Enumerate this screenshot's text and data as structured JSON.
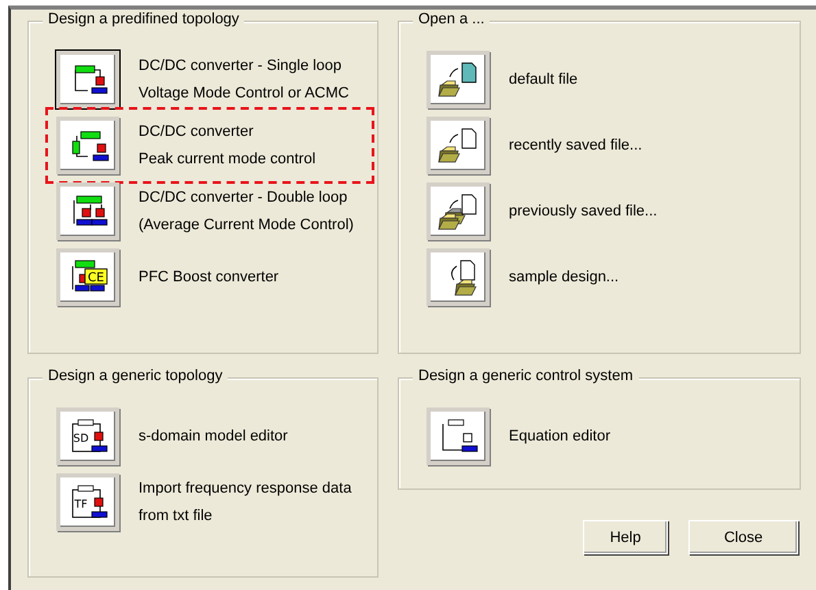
{
  "groups": [
    {
      "title": "Design a predifined topology",
      "items": [
        {
          "kind": "single",
          "lines": [
            "DC/DC converter - Single loop",
            "Voltage Mode Control or ACMC"
          ],
          "focused": true,
          "highlighted": false
        },
        {
          "kind": "peak",
          "lines": [
            "DC/DC converter",
            "Peak current mode control"
          ],
          "focused": false,
          "highlighted": true
        },
        {
          "kind": "double",
          "lines": [
            "DC/DC converter - Double loop",
            "(Average Current Mode Control)"
          ],
          "focused": false,
          "highlighted": false
        },
        {
          "kind": "pfc",
          "lines": [
            "PFC Boost converter"
          ],
          "icon_text": "CE",
          "focused": false,
          "highlighted": false
        }
      ]
    },
    {
      "title": "Open a ...",
      "items": [
        {
          "kind": "default-file",
          "lines": [
            "default file"
          ],
          "focused": false,
          "highlighted": false
        },
        {
          "kind": "recent",
          "lines": [
            "recently saved file..."
          ],
          "focused": false,
          "highlighted": false
        },
        {
          "kind": "previous",
          "lines": [
            "previously saved file..."
          ],
          "focused": false,
          "highlighted": false
        },
        {
          "kind": "sample",
          "lines": [
            "sample design..."
          ],
          "focused": false,
          "highlighted": false
        }
      ]
    },
    {
      "title": "Design a generic topology",
      "items": [
        {
          "kind": "model",
          "lines": [
            "s-domain model editor"
          ],
          "icon_text": "SD",
          "focused": false,
          "highlighted": false
        },
        {
          "kind": "model",
          "lines": [
            "Import frequency response data",
            "from txt file"
          ],
          "icon_text": "TF",
          "focused": false,
          "highlighted": false
        }
      ]
    },
    {
      "title": "Design a generic control system",
      "items": [
        {
          "kind": "equation",
          "lines": [
            "Equation editor"
          ],
          "focused": false,
          "highlighted": false
        }
      ]
    }
  ],
  "buttons": [
    "Help",
    "Close"
  ]
}
